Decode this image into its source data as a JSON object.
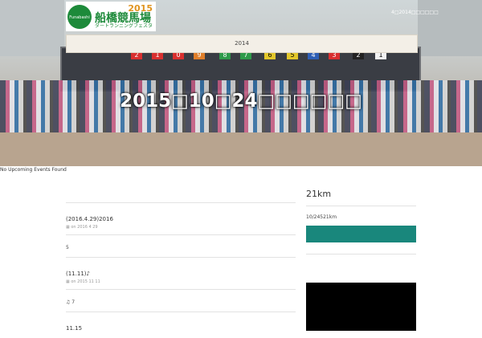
{
  "header": {
    "logo_mark": "Funabashi Race",
    "logo_year": "2015",
    "logo_title": "船橋競馬場",
    "logo_subtitle": "ダートランニングフェスタ",
    "topnav_text": "4□2014□□□□□□",
    "menu_label": "2014"
  },
  "hero": {
    "title": "2015□10□24□□□□□□",
    "gate_numbers": [
      "2",
      "1",
      "0",
      "9",
      "8",
      "7",
      "6",
      "5",
      "4",
      "3",
      "2",
      "1"
    ]
  },
  "events": {
    "empty_text": "No Upcoming Events Found"
  },
  "posts": [
    {
      "title": "(2016.4.29)2016",
      "meta": "on 2016 4 29",
      "body": "5"
    },
    {
      "title": "(11.11)♪",
      "meta": "on 2015 11 11",
      "body": "♫ 7"
    },
    {
      "title": "11.15",
      "meta": "",
      "body": ""
    }
  ],
  "sidebar": {
    "widget_title": "21km",
    "widget_text": "10/24521km",
    "button_color": "#19877c",
    "box_color": "#000000"
  },
  "colors": {
    "accent_green": "#1d8a3a",
    "accent_orange": "#e0941f",
    "button_teal": "#19877c"
  }
}
